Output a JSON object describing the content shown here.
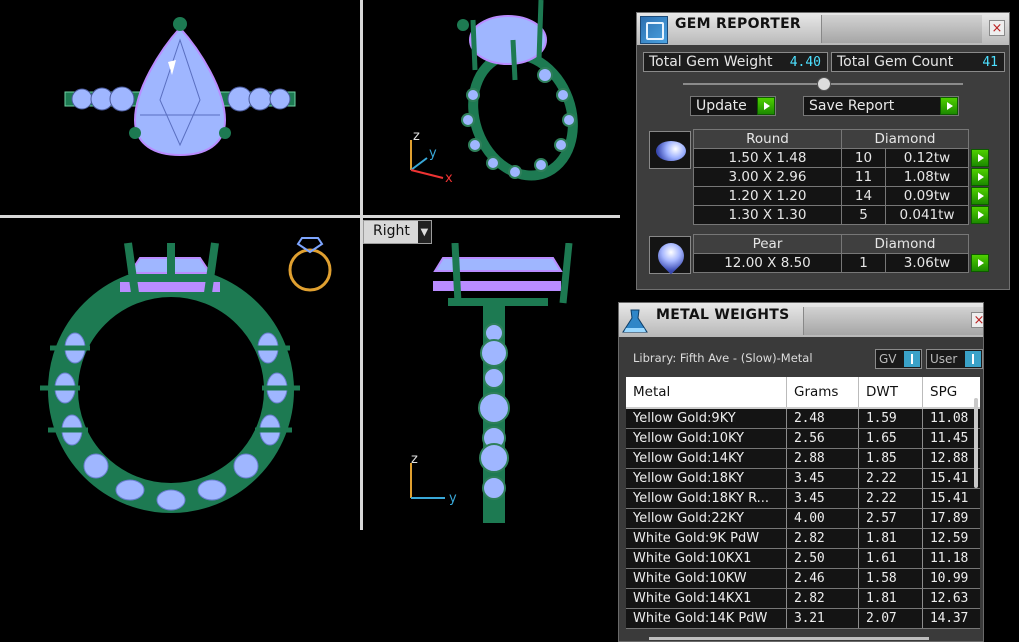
{
  "viewport": {
    "view_selector": "Right",
    "axes": {
      "top_right": [
        "z",
        "y",
        "x"
      ],
      "bottom_right": [
        "z",
        "y"
      ]
    }
  },
  "gem_reporter": {
    "title": "GEM REPORTER",
    "close": "×",
    "total_weight_label": "Total Gem Weight",
    "total_weight_value": "4.40",
    "total_count_label": "Total Gem Count",
    "total_count_value": "41",
    "update_label": "Update",
    "save_label": "Save Report",
    "groups": [
      {
        "shape": "Round",
        "material": "Diamond",
        "rows": [
          {
            "size": "1.50 X 1.48",
            "count": "10",
            "weight": "0.12tw"
          },
          {
            "size": "3.00 X 2.96",
            "count": "11",
            "weight": "1.08tw"
          },
          {
            "size": "1.20 X 1.20",
            "count": "14",
            "weight": "0.09tw"
          },
          {
            "size": "1.30 X 1.30",
            "count": "5",
            "weight": "0.041tw"
          }
        ]
      },
      {
        "shape": "Pear",
        "material": "Diamond",
        "rows": [
          {
            "size": "12.00 X 8.50",
            "count": "1",
            "weight": "3.06tw"
          }
        ]
      }
    ]
  },
  "metal_weights": {
    "title": "METAL WEIGHTS",
    "close": "×",
    "library": "Library: Fifth Ave - (Slow)-Metal",
    "gv_select": "GV",
    "user_select": "User",
    "columns": [
      "Metal",
      "Grams",
      "DWT",
      "SPG"
    ],
    "rows": [
      [
        "Yellow Gold:9KY",
        "2.48",
        "1.59",
        "11.08"
      ],
      [
        "Yellow Gold:10KY",
        "2.56",
        "1.65",
        "11.45"
      ],
      [
        "Yellow Gold:14KY",
        "2.88",
        "1.85",
        "12.88"
      ],
      [
        "Yellow Gold:18KY",
        "3.45",
        "2.22",
        "15.41"
      ],
      [
        "Yellow Gold:18KY R...",
        "3.45",
        "2.22",
        "15.41"
      ],
      [
        "Yellow Gold:22KY",
        "4.00",
        "2.57",
        "17.89"
      ],
      [
        "White Gold:9K PdW",
        "2.82",
        "1.81",
        "12.59"
      ],
      [
        "White Gold:10KX1",
        "2.50",
        "1.61",
        "11.18"
      ],
      [
        "White Gold:10KW",
        "2.46",
        "1.58",
        "10.99"
      ],
      [
        "White Gold:14KX1",
        "2.82",
        "1.81",
        "12.63"
      ],
      [
        "White Gold:14K PdW",
        "3.21",
        "2.07",
        "14.37"
      ]
    ]
  },
  "colors": {
    "ring_metal": "#1d7a52",
    "stone": "#9fb6ff",
    "prong_accent": "#b98cff",
    "axis_x": "#e33",
    "axis_y": "#39a8d8",
    "axis_z": "#e0a030",
    "value_cyan": "#4de0ff",
    "go_green": "#33b000"
  }
}
